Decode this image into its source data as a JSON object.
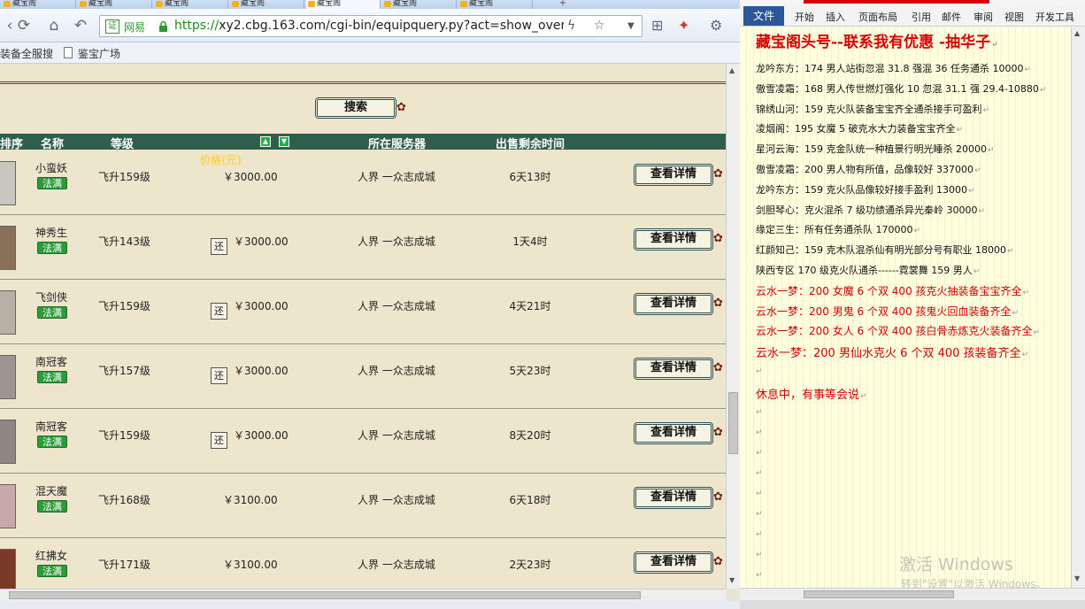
{
  "browser": {
    "tabs": [
      "藏宝阁",
      "藏宝阁",
      "藏宝阁",
      "藏宝阁",
      "藏宝阁",
      "藏宝阁",
      "藏宝阁"
    ],
    "new_tab": "+",
    "site_badge": "网易",
    "url_scheme": "https://",
    "url_rest": "xy2.cbg.163.com/cgi-bin/equipquery.py?act=show_overal",
    "bookmarks": [
      "装备全服搜",
      "鉴宝广场"
    ]
  },
  "page": {
    "search_label": "搜索",
    "headers": {
      "index": "排序",
      "name": "名称",
      "level": "等级",
      "price": "价格(元)",
      "server": "所在服务器",
      "remaining": "出售剩余时间"
    },
    "haggle_label": "还",
    "detail_label": "查看详情",
    "rows": [
      {
        "name": "小蛮妖",
        "badge": "法满",
        "level": "飞升159级",
        "haggle": false,
        "price": "￥3000.00",
        "server": "人界 一众志成城",
        "remaining": "6天13时",
        "avatar_color": "#c9c6c0"
      },
      {
        "name": "神秀生",
        "badge": "法满",
        "level": "飞升143级",
        "haggle": true,
        "price": "￥3000.00",
        "server": "人界 一众志成城",
        "remaining": "1天4时",
        "avatar_color": "#8a7058"
      },
      {
        "name": "飞剑侠",
        "badge": "法满",
        "level": "飞升159级",
        "haggle": true,
        "price": "￥3000.00",
        "server": "人界 一众志成城",
        "remaining": "4天21时",
        "avatar_color": "#b8b0a4"
      },
      {
        "name": "南冠客",
        "badge": "法满",
        "level": "飞升157级",
        "haggle": true,
        "price": "￥3000.00",
        "server": "人界 一众志成城",
        "remaining": "5天23时",
        "avatar_color": "#9a9590"
      },
      {
        "name": "南冠客",
        "badge": "法满",
        "level": "飞升159级",
        "haggle": true,
        "price": "￥3000.00",
        "server": "人界 一众志成城",
        "remaining": "8天20时",
        "avatar_color": "#8c8782"
      },
      {
        "name": "混天魔",
        "badge": "法满",
        "level": "飞升168级",
        "haggle": false,
        "price": "￥3100.00",
        "server": "人界 一众志成城",
        "remaining": "6天18时",
        "avatar_color": "#c8a8a8"
      },
      {
        "name": "红拂女",
        "badge": "法满",
        "level": "飞升171级",
        "haggle": false,
        "price": "￥3100.00",
        "server": "人界 一众志成城",
        "remaining": "2天23时",
        "avatar_color": "#7a3a2a"
      }
    ]
  },
  "word": {
    "file_tab": "文件",
    "menus": [
      "开始",
      "插入",
      "页面布局",
      "引用",
      "邮件",
      "审阅",
      "视图",
      "开发工具"
    ],
    "title": "藏宝阁头号--联系我有优惠 -抽华子",
    "lines": [
      {
        "text": "龙吟东方：174 男人站街忽混 31.8 强混 36 任务通杀 10000",
        "red": false
      },
      {
        "text": "傲雪凌霜：168 男人传世燃灯强化 10 忽混 31.1 强 29.4-10880",
        "red": false
      },
      {
        "text": "锦绣山河：159 克火队装备宝宝齐全通杀接手可盈利",
        "red": false
      },
      {
        "text": "凌烟阁：195 女魔 5 破克水大力装备宝宝齐全",
        "red": false
      },
      {
        "text": "星河云海：159 克金队统一种植景行明光睡杀 20000",
        "red": false
      },
      {
        "text": "傲雪凌霜：200 男人物有所值，品像较好 337000",
        "red": false
      },
      {
        "text": "龙吟东方：159 克火队品像较好接手盈利 13000",
        "red": false
      },
      {
        "text": "剑胆琴心：克火混杀 7 级功绩通杀异光秦岭 30000",
        "red": false
      },
      {
        "text": "缘定三生：所有任务通杀队 170000",
        "red": false
      },
      {
        "text": "红颜知己：159 克木队混杀仙有明光部分号有职业 18000",
        "red": false
      },
      {
        "text": "陕西专区 170 级克火队通杀------霓裳舞 159 男人",
        "red": false
      },
      {
        "text": "云水一梦：200 女魔 6 个双 400 孩克火抽装备宝宝齐全",
        "red": true
      },
      {
        "text": "云水一梦：200 男鬼 6 个双 400 孩鬼火回血装备齐全",
        "red": true
      },
      {
        "text": "云水一梦：200 女人 6 个双 400 孩白骨赤炼克火装备齐全",
        "red": true
      },
      {
        "text": "云水一梦：200 男仙水克火 6 个双 400 孩装备齐全",
        "red": true
      }
    ],
    "rest_note": "休息中，有事等会说",
    "pilcrow": "↵",
    "watermark_line1": "激活 Windows",
    "watermark_line2": "转到\"设置\"以激活 Windows。"
  }
}
